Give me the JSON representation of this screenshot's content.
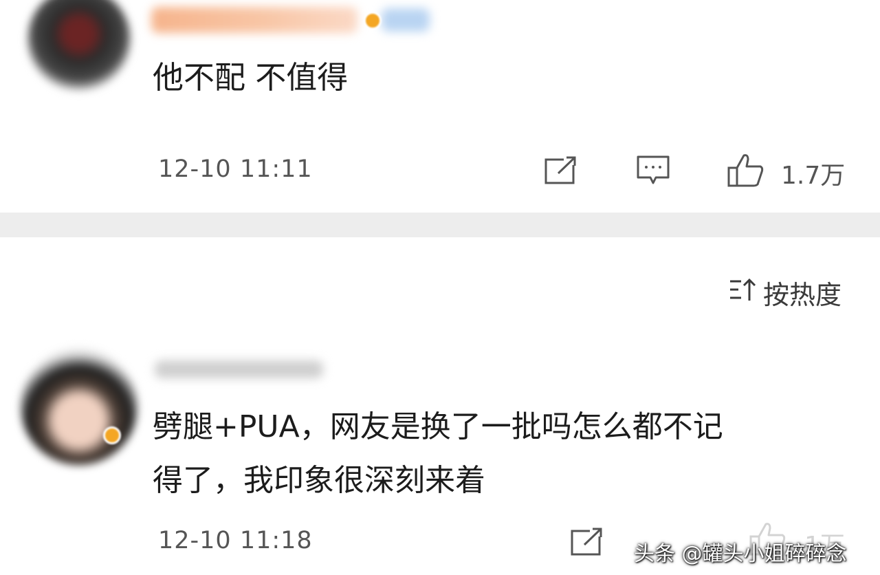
{
  "comments": [
    {
      "text": "他不配 不值得",
      "timestamp": "12-10 11:11",
      "likes": "1.7万"
    },
    {
      "text": "劈腿+PUA，网友是换了一批吗怎么都不记\n得了，我印象很深刻来着",
      "timestamp": "12-10 11:18",
      "likes": "1万"
    }
  ],
  "sort": {
    "label": "按热度"
  },
  "watermark": "头条 @罐头小姐碎碎念",
  "colors": {
    "text": "#1c1c1c",
    "meta": "#555555",
    "divider": "#ededed",
    "badge": "#f4a623"
  },
  "icons": [
    "share-icon",
    "comment-icon",
    "like-icon",
    "sort-icon"
  ]
}
